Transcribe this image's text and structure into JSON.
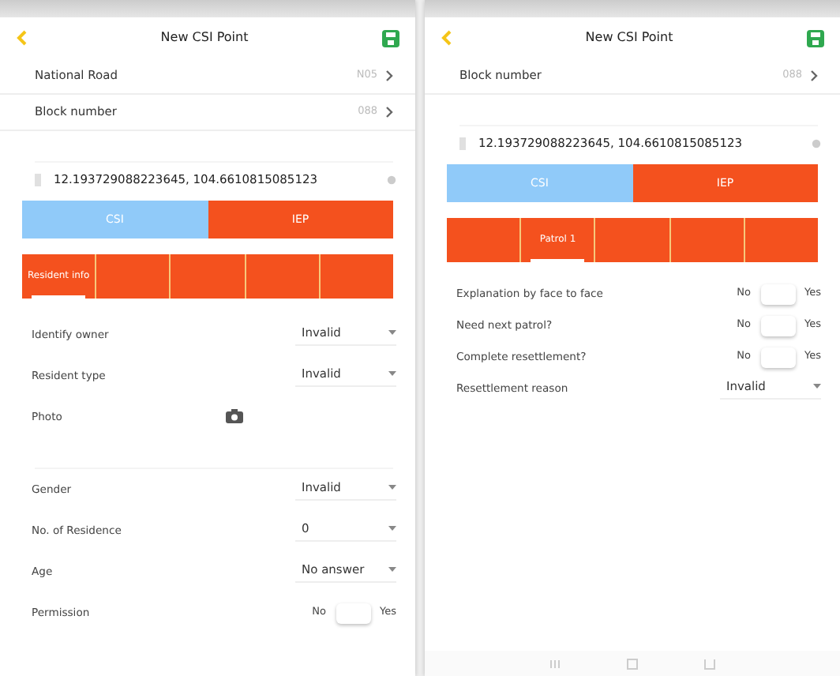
{
  "screens": [
    {
      "title": "New CSI Point",
      "rows": [
        {
          "kind": "link",
          "label": "National Road",
          "value": "N05"
        },
        {
          "kind": "link",
          "label": "Block number",
          "value": "088"
        },
        {
          "kind": "blank"
        },
        {
          "kind": "location",
          "value": "12.193729088223645, 104.6610815085123"
        }
      ],
      "segments": [
        {
          "label": "CSI",
          "selected": false
        },
        {
          "label": "IEP",
          "selected": true
        }
      ],
      "tabs": [
        {
          "label": "Resident info",
          "selected": true
        },
        {
          "selected": false
        },
        {
          "selected": false
        },
        {
          "selected": false
        },
        {
          "selected": false
        }
      ],
      "fields": [
        {
          "kind": "select",
          "label": "Identify owner",
          "value": "Invalid"
        },
        {
          "kind": "select",
          "label": "Resident type",
          "value": "Invalid"
        },
        {
          "kind": "photo",
          "label": "Photo"
        },
        {
          "kind": "blank"
        },
        {
          "kind": "select",
          "label": "Gender",
          "value": "Invalid"
        },
        {
          "kind": "select",
          "label": "No. of Residence",
          "value": "0"
        },
        {
          "kind": "select",
          "label": "Age",
          "value": "No answer"
        },
        {
          "kind": "toggle",
          "label": "Permission",
          "off_label": "No",
          "on_label": "Yes",
          "on": false
        }
      ]
    },
    {
      "title": "New CSI Point",
      "navigation_bar": true,
      "rows": [
        {
          "kind": "link",
          "label": "Block number",
          "value": "088"
        },
        {
          "kind": "blank"
        },
        {
          "kind": "location",
          "value": "12.193729088223645, 104.6610815085123"
        }
      ],
      "segments": [
        {
          "label": "CSI",
          "selected": false
        },
        {
          "label": "IEP",
          "selected": true
        }
      ],
      "tabs": [
        {
          "selected": false
        },
        {
          "label": "Patrol 1",
          "selected": true
        },
        {
          "selected": false
        },
        {
          "selected": false
        },
        {
          "selected": false
        }
      ],
      "fields": [
        {
          "kind": "toggle",
          "label": "Explanation by face to face",
          "off_label": "No",
          "on_label": "Yes",
          "on": false
        },
        {
          "kind": "toggle",
          "label": "Need next patrol?",
          "off_label": "No",
          "on_label": "Yes",
          "on": false
        },
        {
          "kind": "toggle",
          "label": "Complete resettlement?",
          "off_label": "No",
          "on_label": "Yes",
          "on": false
        },
        {
          "kind": "select",
          "label": "Resettlement reason",
          "value": "Invalid"
        }
      ]
    }
  ]
}
